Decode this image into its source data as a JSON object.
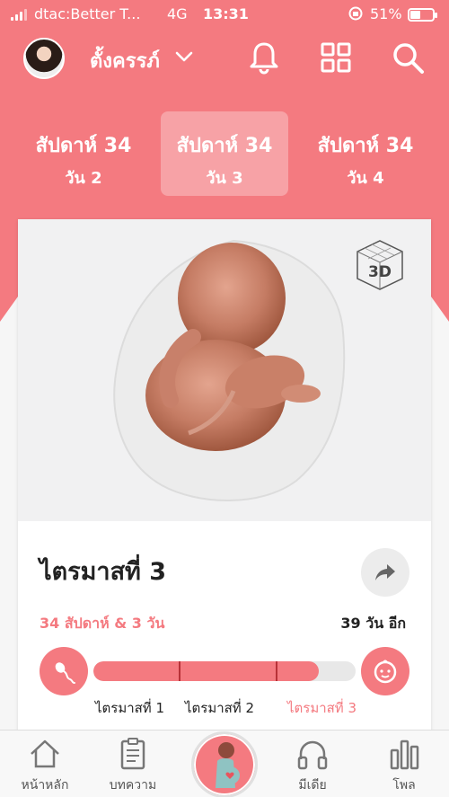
{
  "status_bar": {
    "carrier": "dtac:Better T...",
    "network": "4G",
    "time": "13:31",
    "battery": "51%",
    "battery_level": 0.51
  },
  "header": {
    "profile_name": "ตั้งครรภ์",
    "accent_color": "#f47a80"
  },
  "day_tabs": [
    {
      "week": "สัปดาห์ 34",
      "day": "วัน 2",
      "active": false
    },
    {
      "week": "สัปดาห์ 34",
      "day": "วัน 3",
      "active": true
    },
    {
      "week": "สัปดาห์ 34",
      "day": "วัน 4",
      "active": false
    }
  ],
  "card": {
    "badge": "3D",
    "title": "ไตรมาสที่ 3",
    "progress_text": "34 สัปดาห์ & 3 วัน",
    "remaining_text": "39 วัน อีก",
    "progress_fraction": 0.86,
    "trimesters": [
      {
        "label": "ไตรมาสที่ 1",
        "active": false
      },
      {
        "label": "ไตรมาสที่ 2",
        "active": false
      },
      {
        "label": "ไตรมาสที่ 3",
        "active": true
      }
    ]
  },
  "bottom_nav": {
    "items": [
      {
        "label": "หน้าหลัก",
        "icon": "home-icon"
      },
      {
        "label": "บทความ",
        "icon": "article-icon"
      },
      {
        "label": "",
        "icon": "pregnancy-icon"
      },
      {
        "label": "มีเดีย",
        "icon": "headphones-icon"
      },
      {
        "label": "โพล",
        "icon": "poll-icon"
      }
    ]
  }
}
